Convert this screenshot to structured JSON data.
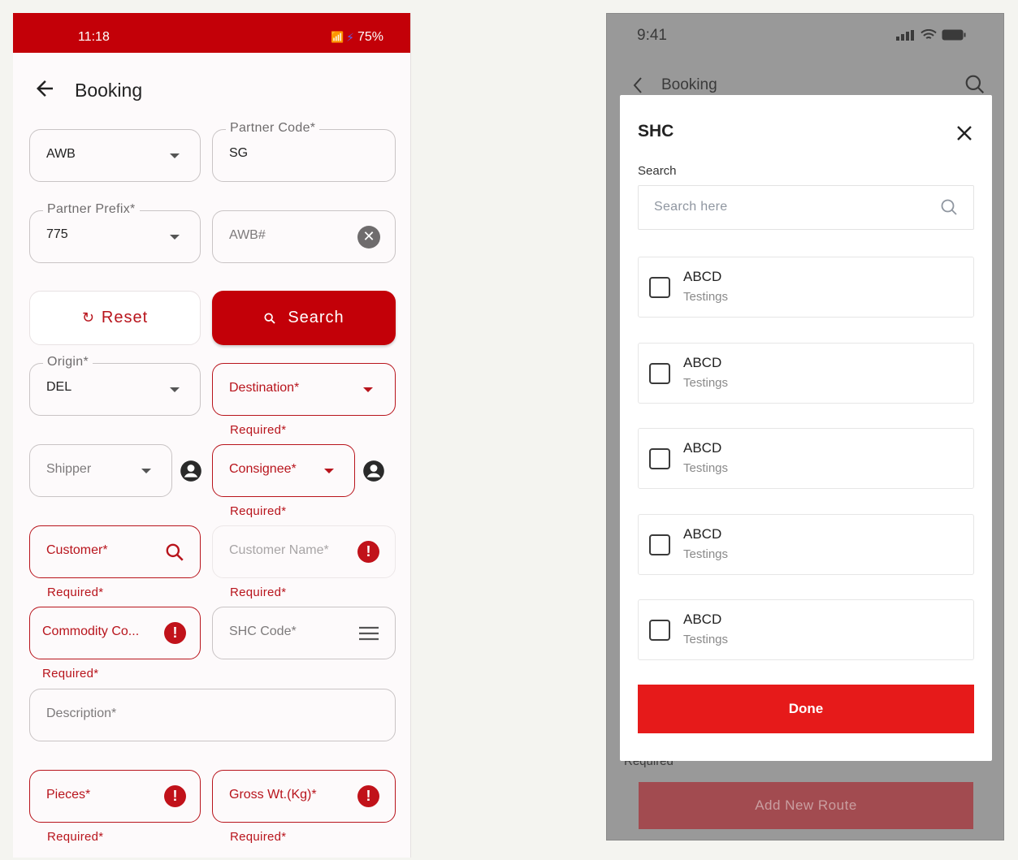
{
  "left": {
    "status": {
      "time": "11:18",
      "signal": "\u0001",
      "battery": "75%"
    },
    "header": {
      "title": "Booking"
    },
    "fields": {
      "doc_type": {
        "value": "AWB"
      },
      "partner_code": {
        "label": "Partner Code*",
        "value": "SG"
      },
      "partner_prefix": {
        "label": "Partner Prefix*",
        "value": "775"
      },
      "awb": {
        "placeholder": "AWB#"
      },
      "origin": {
        "label": "Origin*",
        "value": "DEL"
      },
      "destination": {
        "placeholder": "Destination*",
        "error": "Required*"
      },
      "shipper": {
        "placeholder": "Shipper"
      },
      "consignee": {
        "placeholder": "Consignee*",
        "error": "Required*"
      },
      "customer": {
        "placeholder": "Customer*",
        "error": "Required*"
      },
      "customer_name": {
        "placeholder": "Customer Name*",
        "error": "Required*"
      },
      "commodity": {
        "placeholder": "Commodity Co...",
        "error": "Required*"
      },
      "shc_code": {
        "placeholder": "SHC Code*"
      },
      "description": {
        "placeholder": "Description*"
      },
      "pieces": {
        "placeholder": "Pieces*",
        "error": "Required*"
      },
      "gross_wt": {
        "placeholder": "Gross Wt.(Kg)*",
        "error": "Required*"
      }
    },
    "buttons": {
      "reset": "Reset",
      "search": "Search"
    },
    "colors": {
      "brand": "#c30008",
      "error": "#b8141c"
    }
  },
  "right": {
    "status": {
      "time": "9:41"
    },
    "header": {
      "title": "Booking"
    },
    "behind": {
      "required": "Required*",
      "add_route": "Add New Route"
    },
    "modal": {
      "title": "SHC",
      "search_label": "Search",
      "search_placeholder": "Search here",
      "options": [
        {
          "title": "ABCD",
          "subtitle": "Testings"
        },
        {
          "title": "ABCD",
          "subtitle": "Testings"
        },
        {
          "title": "ABCD",
          "subtitle": "Testings"
        },
        {
          "title": "ABCD",
          "subtitle": "Testings"
        },
        {
          "title": "ABCD",
          "subtitle": "Testings"
        }
      ],
      "done": "Done"
    }
  }
}
